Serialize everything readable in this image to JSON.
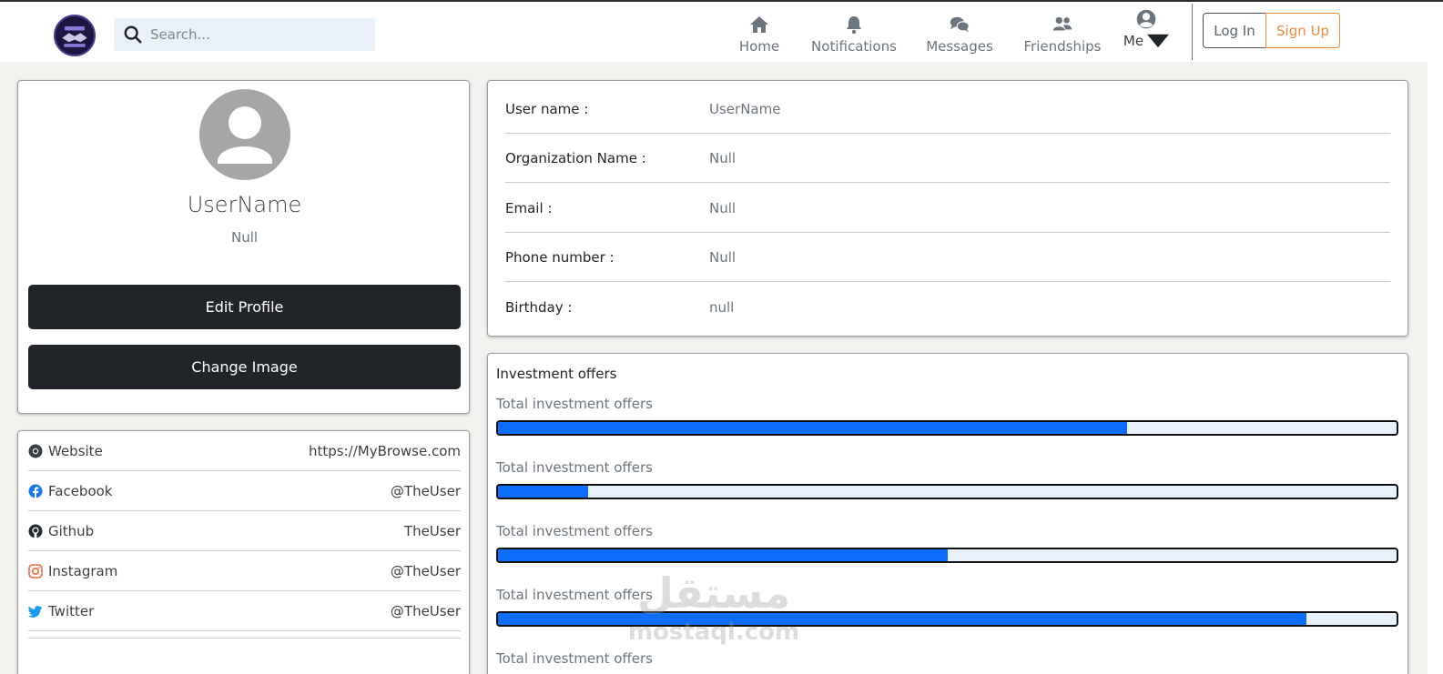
{
  "nav": {
    "search_placeholder": "Search...",
    "home": "Home",
    "notifications": "Notifications",
    "messages": "Messages",
    "friendships": "Friendships",
    "me": "Me",
    "login": "Log In",
    "signup": "Sign Up"
  },
  "profile": {
    "name": "UserName",
    "subtitle": "Null",
    "edit_button": "Edit Profile",
    "change_image_button": "Change Image"
  },
  "social": [
    {
      "label": "Website",
      "value": "https://MyBrowse.com",
      "icon": "chrome-icon"
    },
    {
      "label": "Facebook",
      "value": "@TheUser",
      "icon": "facebook-icon"
    },
    {
      "label": "Github",
      "value": "TheUser",
      "icon": "github-icon"
    },
    {
      "label": "Instagram",
      "value": "@TheUser",
      "icon": "instagram-icon"
    },
    {
      "label": "Twitter",
      "value": "@TheUser",
      "icon": "twitter-icon"
    }
  ],
  "info": [
    {
      "label": "User name :",
      "value": "UserName"
    },
    {
      "label": "Organization Name :",
      "value": "Null"
    },
    {
      "label": "Email :",
      "value": "Null"
    },
    {
      "label": "Phone number :",
      "value": "Null"
    },
    {
      "label": "Birthday :",
      "value": "null"
    }
  ],
  "investment": {
    "title": "Investment offers",
    "items": [
      {
        "label": "Total investment offers",
        "percent": 70
      },
      {
        "label": "Total investment offers",
        "percent": 10
      },
      {
        "label": "Total investment offers",
        "percent": 50
      },
      {
        "label": "Total investment offers",
        "percent": 90
      },
      {
        "label": "Total investment offers",
        "percent": 0
      }
    ]
  },
  "watermark": {
    "arabic": "مستقل",
    "latin": "mostaql.com"
  },
  "colors": {
    "accent": "#0d6efd",
    "dark_button": "#212529",
    "signup": "#f0883e"
  }
}
